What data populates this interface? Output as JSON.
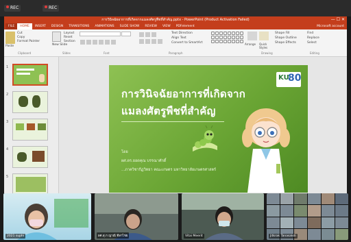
{
  "recording": {
    "badge1": "REC",
    "badge2": "REC"
  },
  "window": {
    "title": "การวินิจฉัยอาการที่เกิดจากแมลงศัตรูพืชที่สำคัญ.pptx - PowerPoint (Product Activation Failed)",
    "controls": "— ☐ ✕"
  },
  "ribbon": {
    "tabs": [
      "FILE",
      "HOME",
      "INSERT",
      "DESIGN",
      "TRANSITIONS",
      "ANIMATIONS",
      "SLIDE SHOW",
      "REVIEW",
      "VIEW",
      "PDFelement"
    ],
    "account": "Microsoft account",
    "clipboard": {
      "paste": "Paste",
      "cut": "Cut",
      "copy": "Copy",
      "format_painter": "Format Painter",
      "label": "Clipboard"
    },
    "slides": {
      "new_slide": "New Slide",
      "layout": "Layout",
      "reset": "Reset",
      "section": "Section",
      "label": "Slides"
    },
    "font_label": "Font",
    "paragraph": {
      "text_direction": "Text Direction",
      "align_text": "Align Text",
      "convert": "Convert to SmartArt",
      "label": "Paragraph"
    },
    "drawing": {
      "arrange": "Arrange",
      "quick_styles": "Quick Styles",
      "shape_fill": "Shape Fill",
      "shape_outline": "Shape Outline",
      "shape_effects": "Shape Effects",
      "label": "Drawing"
    },
    "editing": {
      "find": "Find",
      "replace": "Replace",
      "select": "Select",
      "label": "Editing"
    }
  },
  "thumbnails": [
    "1",
    "2",
    "3",
    "4",
    "5"
  ],
  "slide": {
    "title_line1": "การวินิจฉัยอาการที่เกิดจาก",
    "title_line2": "แมลงศัตรูพืชที่สำคัญ",
    "by": "โดย",
    "author": "ผศ.ดร.ยอดคุณ บรรณาศักดิ์",
    "dept": "...ภาควิชากีฏวิทยา คณะเกษตร มหาวิทยาลัยเกษตรศาสตร์",
    "logo_text": "KU",
    "logo_num": "80"
  },
  "participants": [
    {
      "name": "2021 suphi"
    },
    {
      "name": "ผศ.สุ.ก ญาณี ทีลาไชย"
    },
    {
      "name": "Vitai Meerit"
    },
    {
      "name": "Jitkrak Tanasakdi"
    }
  ],
  "colors": {
    "ppt_red": "#c43e1c",
    "slide_green": "#6aa534"
  }
}
